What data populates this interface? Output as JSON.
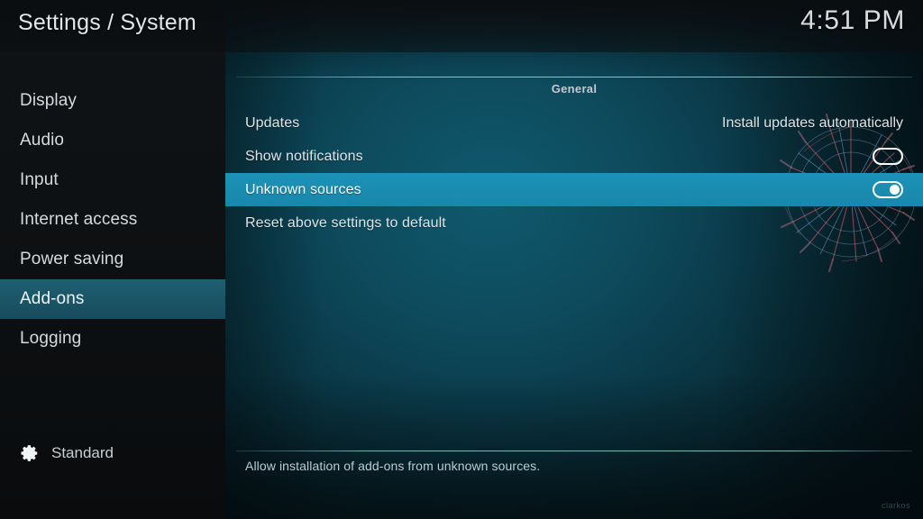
{
  "window": {
    "title": "Settings / System",
    "clock": "4:51 PM"
  },
  "sidebar": {
    "items": [
      {
        "label": "Display",
        "selected": false
      },
      {
        "label": "Audio",
        "selected": false
      },
      {
        "label": "Input",
        "selected": false
      },
      {
        "label": "Internet access",
        "selected": false
      },
      {
        "label": "Power saving",
        "selected": false
      },
      {
        "label": "Add-ons",
        "selected": true
      },
      {
        "label": "Logging",
        "selected": false
      }
    ],
    "profile": {
      "icon": "gear-icon",
      "label": "Standard"
    }
  },
  "main": {
    "group_title": "General",
    "rows": [
      {
        "label": "Updates",
        "type": "value",
        "value": "Install updates automatically",
        "selected": false
      },
      {
        "label": "Show notifications",
        "type": "toggle",
        "value": "off",
        "selected": false
      },
      {
        "label": "Unknown sources",
        "type": "toggle",
        "value": "on",
        "selected": true
      },
      {
        "label": "Reset above settings to default",
        "type": "action",
        "value": "",
        "selected": false
      }
    ],
    "description": "Allow installation of add-ons from unknown sources."
  },
  "watermark": "clarkos",
  "colors": {
    "sidebar_bg": "#0e1113",
    "panel_bg": "#0d4a5c",
    "row_highlight": "#1a8cb0",
    "sidebar_highlight": "#1a5566",
    "rule": "#96d7e6",
    "text": "#dfe4e7",
    "description_text": "#b9ccd4"
  }
}
